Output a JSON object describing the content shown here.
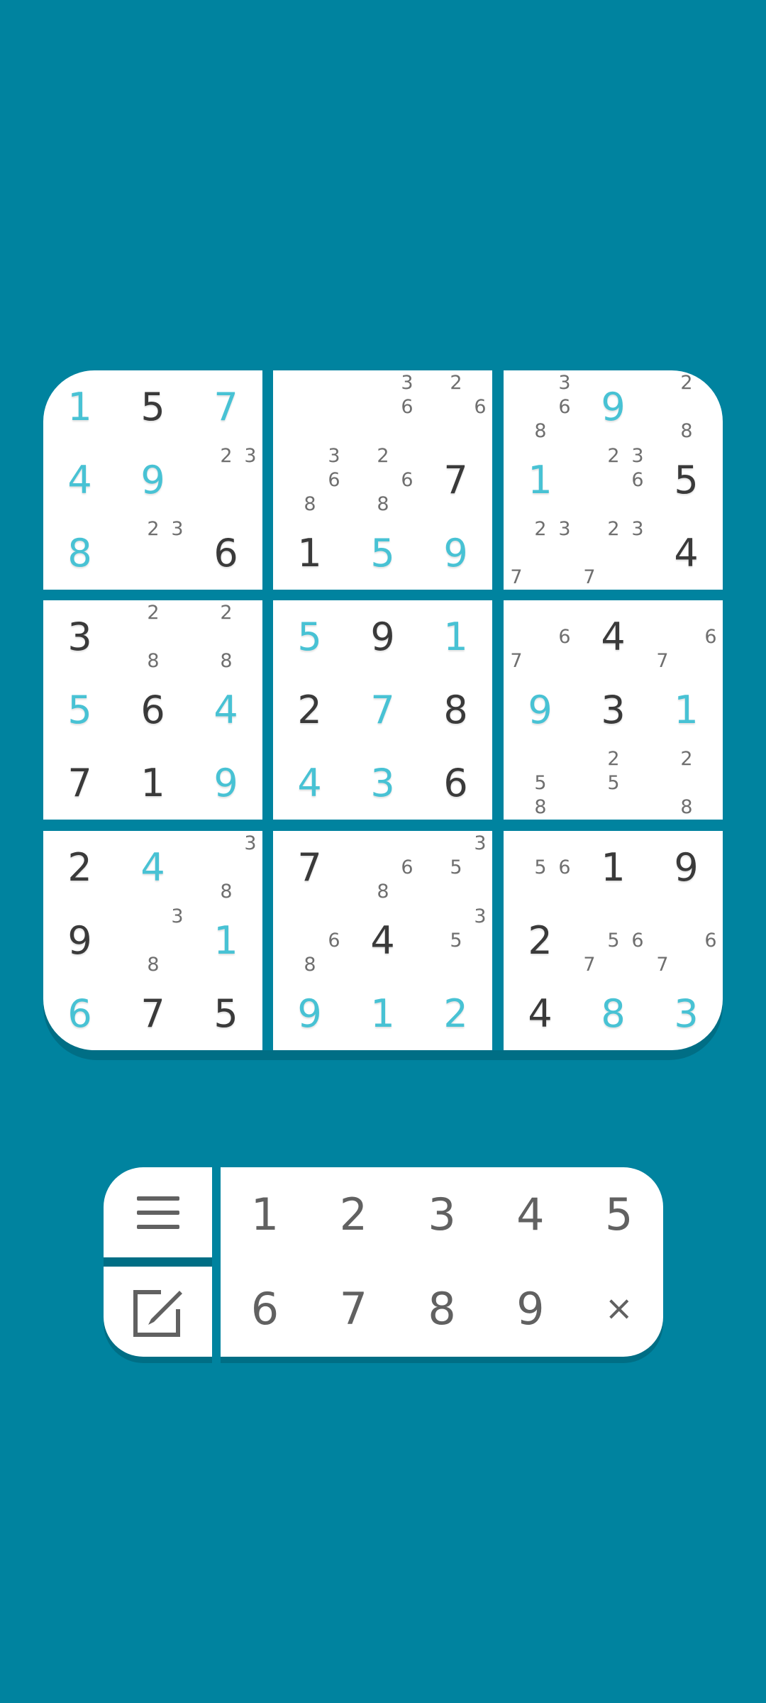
{
  "board": [
    [
      {
        "v": "1",
        "t": "user"
      },
      {
        "v": "5",
        "t": "given"
      },
      {
        "v": "7",
        "t": "user"
      },
      {
        "v": "",
        "n": []
      },
      {
        "v": "",
        "n": [
          "3",
          "6"
        ]
      },
      {
        "v": "",
        "n": [
          "2",
          "6"
        ]
      },
      {
        "v": "",
        "n": [
          "3",
          "6",
          "8"
        ]
      },
      {
        "v": "9",
        "t": "user"
      },
      {
        "v": "",
        "n": [
          "2",
          "8"
        ]
      }
    ],
    [
      {
        "v": "4",
        "t": "user"
      },
      {
        "v": "9",
        "t": "user"
      },
      {
        "v": "",
        "n": [
          "2",
          "3"
        ]
      },
      {
        "v": "",
        "n": [
          "3",
          "6",
          "8"
        ]
      },
      {
        "v": "",
        "n": [
          "2",
          "6",
          "8"
        ]
      },
      {
        "v": "7",
        "t": "given"
      },
      {
        "v": "1",
        "t": "user"
      },
      {
        "v": "",
        "n": [
          "2",
          "3",
          "6"
        ]
      },
      {
        "v": "5",
        "t": "given"
      }
    ],
    [
      {
        "v": "8",
        "t": "user"
      },
      {
        "v": "",
        "n": [
          "2",
          "3"
        ]
      },
      {
        "v": "6",
        "t": "given"
      },
      {
        "v": "1",
        "t": "given"
      },
      {
        "v": "5",
        "t": "user"
      },
      {
        "v": "9",
        "t": "user"
      },
      {
        "v": "",
        "n": [
          "2",
          "3",
          "7"
        ]
      },
      {
        "v": "",
        "n": [
          "2",
          "3",
          "7"
        ]
      },
      {
        "v": "4",
        "t": "given"
      }
    ],
    [
      {
        "v": "3",
        "t": "given"
      },
      {
        "v": "",
        "n": [
          "2",
          "8"
        ]
      },
      {
        "v": "",
        "n": [
          "2",
          "8"
        ]
      },
      {
        "v": "5",
        "t": "user"
      },
      {
        "v": "9",
        "t": "given"
      },
      {
        "v": "1",
        "t": "user"
      },
      {
        "v": "",
        "n": [
          "6",
          "7"
        ]
      },
      {
        "v": "4",
        "t": "given"
      },
      {
        "v": "",
        "n": [
          "6",
          "7"
        ]
      }
    ],
    [
      {
        "v": "5",
        "t": "user"
      },
      {
        "v": "6",
        "t": "given"
      },
      {
        "v": "4",
        "t": "user"
      },
      {
        "v": "2",
        "t": "given"
      },
      {
        "v": "7",
        "t": "user"
      },
      {
        "v": "8",
        "t": "given"
      },
      {
        "v": "9",
        "t": "user"
      },
      {
        "v": "3",
        "t": "given"
      },
      {
        "v": "1",
        "t": "user"
      }
    ],
    [
      {
        "v": "7",
        "t": "given"
      },
      {
        "v": "1",
        "t": "given"
      },
      {
        "v": "9",
        "t": "user"
      },
      {
        "v": "4",
        "t": "user"
      },
      {
        "v": "3",
        "t": "user"
      },
      {
        "v": "6",
        "t": "given"
      },
      {
        "v": "",
        "n": [
          "5",
          "8"
        ]
      },
      {
        "v": "",
        "n": [
          "2",
          "5"
        ]
      },
      {
        "v": "",
        "n": [
          "2",
          "8"
        ]
      }
    ],
    [
      {
        "v": "2",
        "t": "given"
      },
      {
        "v": "4",
        "t": "user"
      },
      {
        "v": "",
        "n": [
          "3",
          "8"
        ]
      },
      {
        "v": "7",
        "t": "given"
      },
      {
        "v": "",
        "n": [
          "6",
          "8"
        ]
      },
      {
        "v": "",
        "n": [
          "3",
          "5"
        ]
      },
      {
        "v": "",
        "n": [
          "5",
          "6"
        ]
      },
      {
        "v": "1",
        "t": "given"
      },
      {
        "v": "9",
        "t": "given"
      }
    ],
    [
      {
        "v": "9",
        "t": "given"
      },
      {
        "v": "",
        "n": [
          "3",
          "8"
        ]
      },
      {
        "v": "1",
        "t": "user"
      },
      {
        "v": "",
        "n": [
          "6",
          "8"
        ]
      },
      {
        "v": "4",
        "t": "given"
      },
      {
        "v": "",
        "n": [
          "3",
          "5"
        ]
      },
      {
        "v": "2",
        "t": "given"
      },
      {
        "v": "",
        "n": [
          "5",
          "6",
          "7"
        ]
      },
      {
        "v": "",
        "n": [
          "6",
          "7"
        ]
      }
    ],
    [
      {
        "v": "6",
        "t": "user"
      },
      {
        "v": "7",
        "t": "given"
      },
      {
        "v": "5",
        "t": "given"
      },
      {
        "v": "9",
        "t": "user"
      },
      {
        "v": "1",
        "t": "user"
      },
      {
        "v": "2",
        "t": "user"
      },
      {
        "v": "4",
        "t": "given"
      },
      {
        "v": "8",
        "t": "user"
      },
      {
        "v": "3",
        "t": "user"
      }
    ]
  ],
  "keypad": {
    "keys": [
      "1",
      "2",
      "3",
      "4",
      "5",
      "6",
      "7",
      "8",
      "9",
      "×"
    ],
    "menu_icon": "menu-icon",
    "notes_icon": "pencil-edit-icon"
  },
  "colors": {
    "background": "#00839f",
    "given_digit": "#3a3a3a",
    "user_digit": "#48c2d4",
    "note_digit": "#6f6f6f",
    "key_digit": "#616161",
    "panel": "#ffffff"
  }
}
